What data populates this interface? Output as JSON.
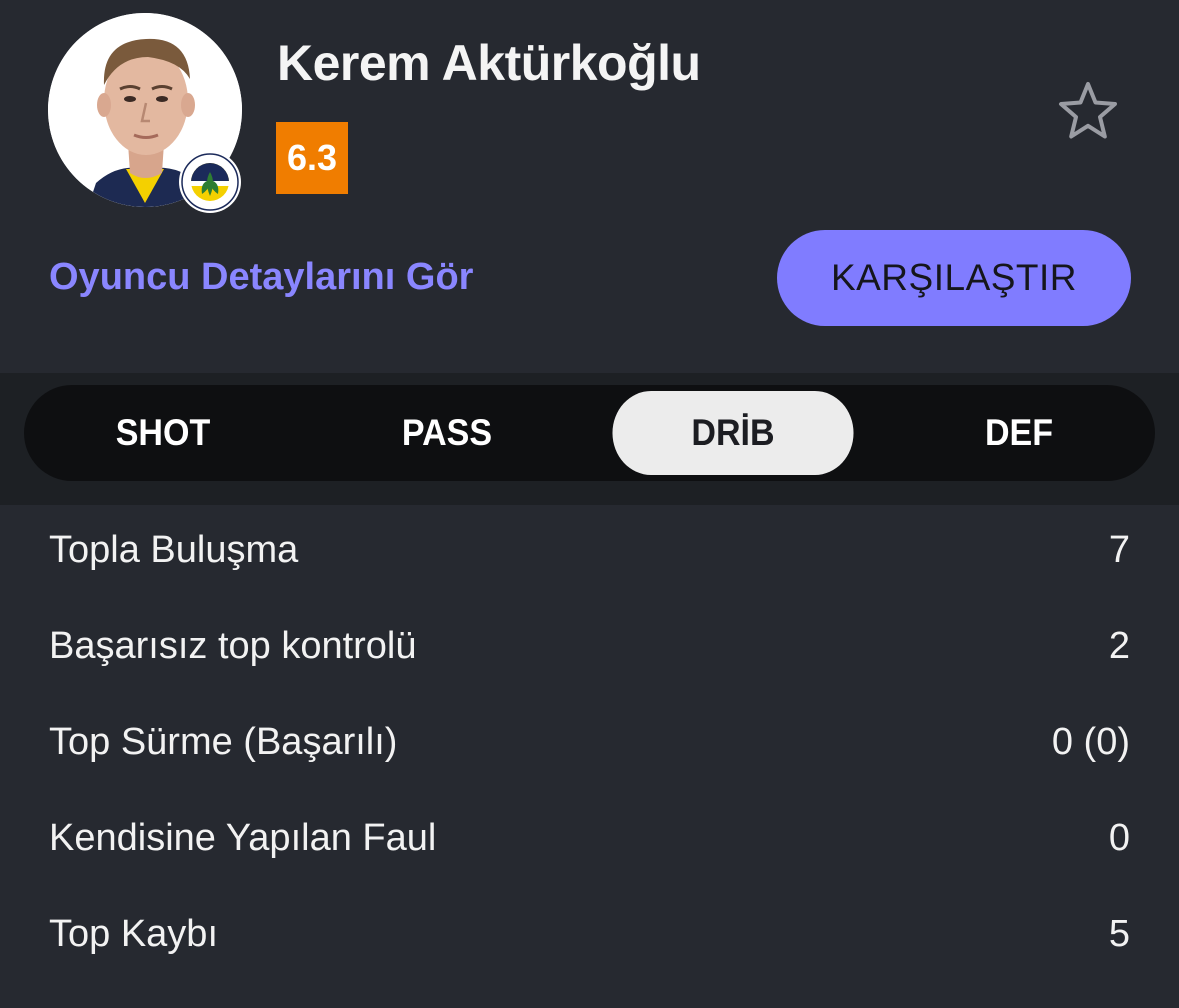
{
  "player": {
    "name": "Kerem Aktürkoğlu",
    "rating": "6.3",
    "rating_color": "#f07d00"
  },
  "icons": {
    "avatar": "player-photo",
    "club": "fenerbahce-badge-icon",
    "favorite": "star-outline-icon"
  },
  "actions": {
    "details_link": "Oyuncu Detaylarını Gör",
    "compare_button": "KARŞILAŞTIR"
  },
  "tabs": [
    {
      "label": "SHOT",
      "active": false
    },
    {
      "label": "PASS",
      "active": false
    },
    {
      "label": "DRİB",
      "active": true
    },
    {
      "label": "DEF",
      "active": false
    }
  ],
  "stats": [
    {
      "label": "Topla Buluşma",
      "value": "7"
    },
    {
      "label": "Başarısız top kontrolü",
      "value": "2"
    },
    {
      "label": "Top Sürme (Başarılı)",
      "value": "0 (0)"
    },
    {
      "label": "Kendisine Yapılan Faul",
      "value": "0"
    },
    {
      "label": "Top Kaybı",
      "value": "5"
    }
  ],
  "colors": {
    "background": "#262930",
    "accent": "#807cff",
    "link": "#8a86ff"
  }
}
